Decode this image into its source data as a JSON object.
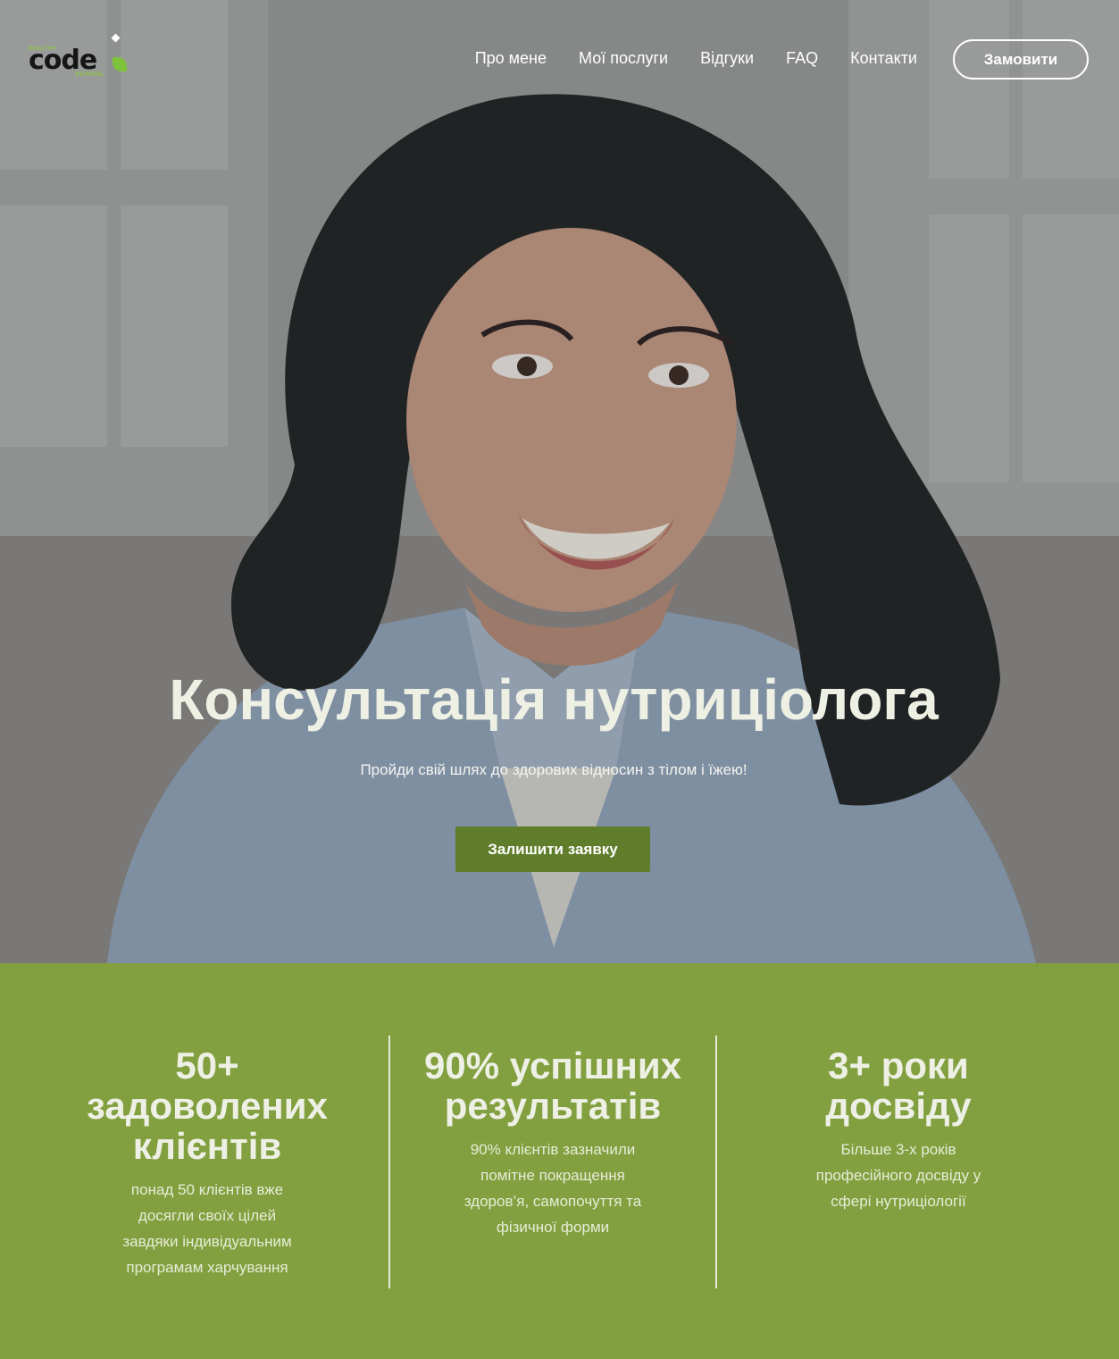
{
  "nav": {
    "logo": {
      "top": "HEALTHY",
      "main": "code",
      "bottom": "SCHOOL"
    },
    "items": [
      {
        "label": "Про мене"
      },
      {
        "label": "Мої послуги"
      },
      {
        "label": "Відгуки"
      },
      {
        "label": "FAQ"
      },
      {
        "label": "Контакти"
      }
    ],
    "order_button": "Замовити"
  },
  "hero": {
    "title": "Консультація нутриціолога",
    "subtitle": "Пройди свій шлях до здорових відносин з тілом і їжею!",
    "cta": "Залишити заявку"
  },
  "stats": [
    {
      "title_lines": [
        "50+",
        "задоволених",
        "клієнтів"
      ],
      "desc_lines": [
        "понад 50 клієнтів вже",
        "досягли своїх цілей",
        "завдяки індивідуальним",
        "програмам харчування"
      ]
    },
    {
      "title_lines": [
        "90% успішних",
        "результатів"
      ],
      "desc_lines": [
        "90% клієнтів зазначили",
        "помітне покращення",
        "здоров’я, самопочуття та",
        "фізичної форми"
      ]
    },
    {
      "title_lines": [
        "3+ роки",
        "досвіду"
      ],
      "desc_lines": [
        "Більше 3-х років",
        "професійного досвіду у",
        "сфері нутриціології"
      ]
    }
  ],
  "colors": {
    "accent_green": "#82a03f",
    "cta_green": "#5f7d2a",
    "logo_green": "#8cc63f"
  }
}
